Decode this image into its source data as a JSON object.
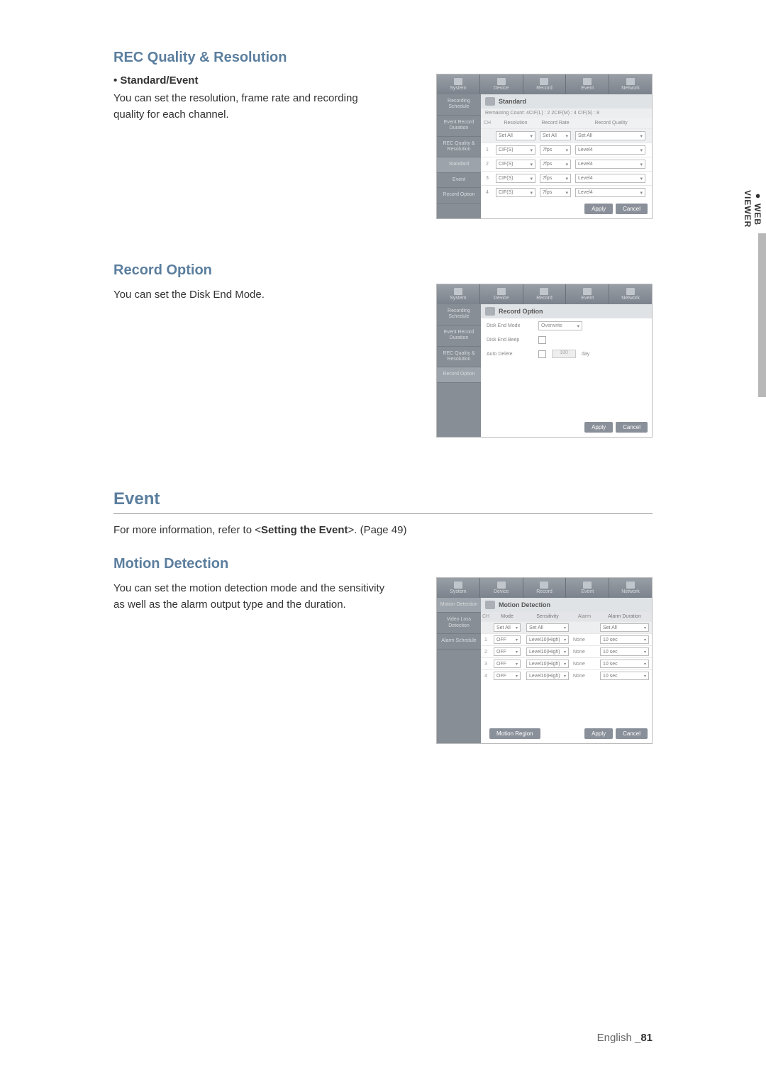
{
  "headings": {
    "rec_quality": "REC Quality & Resolution",
    "standard_event_bullet": "• Standard/Event",
    "rec_quality_desc": "You can set the resolution, frame rate and recording quality for each channel.",
    "record_option": "Record Option",
    "record_option_desc": "You can set the Disk End Mode.",
    "event": "Event",
    "event_intro_pre": "For more information, refer to <",
    "event_intro_bold": "Setting the Event",
    "event_intro_post": ">. (Page 49)",
    "motion_detection": "Motion Detection",
    "motion_desc": "You can set the motion detection mode and the sensitivity as well as the alarm output type and the duration."
  },
  "tabs": {
    "system": "System",
    "device": "Device",
    "record": "Record",
    "event": "Event",
    "network": "Network"
  },
  "panel_standard": {
    "title": "Standard",
    "remaining": "Remaining Count:   4CIF(L) : 2        2CIF(M) :   4        CIF(S) :  8",
    "sidebar": {
      "recording_schedule": "Recording Schedule",
      "event_record_duration": "Event Record Duration",
      "rec_quality": "REC Quality & Resolution",
      "standard": "Standard",
      "event": "Event",
      "record_option": "Record Option"
    },
    "headers": {
      "ch": "CH",
      "resolution": "Resolution",
      "record_rate": "Record Rate",
      "record_quality": "Record Quality"
    },
    "set_all": "Set All",
    "rows": [
      {
        "ch": "1",
        "res": "CIF(S)",
        "rate": "7fps",
        "qual": "Level4"
      },
      {
        "ch": "2",
        "res": "CIF(S)",
        "rate": "7fps",
        "qual": "Level4"
      },
      {
        "ch": "3",
        "res": "CIF(S)",
        "rate": "7fps",
        "qual": "Level4"
      },
      {
        "ch": "4",
        "res": "CIF(S)",
        "rate": "7fps",
        "qual": "Level4"
      }
    ],
    "apply": "Apply",
    "cancel": "Cancel"
  },
  "panel_record_option": {
    "title": "Record Option",
    "disk_end_mode": "Disk End Mode",
    "disk_end_value": "Overwrite",
    "disk_end_beep": "Disk End Beep",
    "auto_delete": "Auto Delete",
    "auto_delete_val": "180",
    "auto_delete_unit": "day",
    "apply": "Apply",
    "cancel": "Cancel"
  },
  "panel_motion": {
    "title": "Motion Detection",
    "sidebar": {
      "motion_detection": "Motion Detection",
      "video_loss": "Video Loss Detection",
      "alarm_schedule": "Alarm Schedule"
    },
    "headers": {
      "ch": "CH",
      "mode": "Mode",
      "sensitivity": "Sensitivity",
      "alarm": "Alarm",
      "alarm_duration": "Alarm Duration"
    },
    "set_all": "Set All",
    "rows": [
      {
        "ch": "1",
        "mode": "OFF",
        "sens": "Level10(High)",
        "alarm": "None",
        "dur": "10 sec"
      },
      {
        "ch": "2",
        "mode": "OFF",
        "sens": "Level10(High)",
        "alarm": "None",
        "dur": "10 sec"
      },
      {
        "ch": "3",
        "mode": "OFF",
        "sens": "Level10(High)",
        "alarm": "None",
        "dur": "10 sec"
      },
      {
        "ch": "4",
        "mode": "OFF",
        "sens": "Level10(High)",
        "alarm": "None",
        "dur": "10 sec"
      }
    ],
    "motion_region": "Motion Region",
    "apply": "Apply",
    "cancel": "Cancel"
  },
  "side_tab": {
    "bullet": "●",
    "label": "WEB VIEWER"
  },
  "footer": {
    "lang": "English _",
    "page": "81"
  }
}
